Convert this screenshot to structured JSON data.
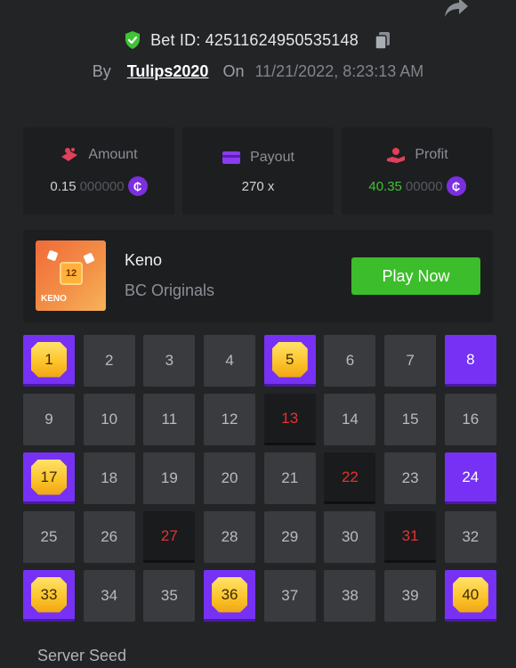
{
  "header": {
    "bet_id_label": "Bet ID: 42511624950535148",
    "by": "By",
    "user": "Tulips2020",
    "on": "On",
    "datetime": "11/21/2022, 8:23:13 AM"
  },
  "stats": {
    "amount": {
      "label": "Amount",
      "value_main": "0.15",
      "value_dim": "000000"
    },
    "payout": {
      "label": "Payout",
      "value": "270 x"
    },
    "profit": {
      "label": "Profit",
      "value_main": "40.35",
      "value_dim": "00000"
    }
  },
  "coin_symbol": "₵",
  "game": {
    "thumb_number": "12",
    "thumb_label": "KENO",
    "title": "Keno",
    "subtitle": "BC Originals",
    "play_label": "Play Now"
  },
  "grid": [
    {
      "n": "1",
      "s": "gem"
    },
    {
      "n": "2",
      "s": "none"
    },
    {
      "n": "3",
      "s": "none"
    },
    {
      "n": "4",
      "s": "none"
    },
    {
      "n": "5",
      "s": "gem"
    },
    {
      "n": "6",
      "s": "none"
    },
    {
      "n": "7",
      "s": "none"
    },
    {
      "n": "8",
      "s": "sel"
    },
    {
      "n": "9",
      "s": "none"
    },
    {
      "n": "10",
      "s": "none"
    },
    {
      "n": "11",
      "s": "none"
    },
    {
      "n": "12",
      "s": "none"
    },
    {
      "n": "13",
      "s": "miss"
    },
    {
      "n": "14",
      "s": "none"
    },
    {
      "n": "15",
      "s": "none"
    },
    {
      "n": "16",
      "s": "none"
    },
    {
      "n": "17",
      "s": "gem"
    },
    {
      "n": "18",
      "s": "none"
    },
    {
      "n": "19",
      "s": "none"
    },
    {
      "n": "20",
      "s": "none"
    },
    {
      "n": "21",
      "s": "none"
    },
    {
      "n": "22",
      "s": "miss"
    },
    {
      "n": "23",
      "s": "none"
    },
    {
      "n": "24",
      "s": "sel"
    },
    {
      "n": "25",
      "s": "none"
    },
    {
      "n": "26",
      "s": "none"
    },
    {
      "n": "27",
      "s": "miss"
    },
    {
      "n": "28",
      "s": "none"
    },
    {
      "n": "29",
      "s": "none"
    },
    {
      "n": "30",
      "s": "none"
    },
    {
      "n": "31",
      "s": "miss"
    },
    {
      "n": "32",
      "s": "none"
    },
    {
      "n": "33",
      "s": "gem"
    },
    {
      "n": "34",
      "s": "none"
    },
    {
      "n": "35",
      "s": "none"
    },
    {
      "n": "36",
      "s": "gem"
    },
    {
      "n": "37",
      "s": "none"
    },
    {
      "n": "38",
      "s": "none"
    },
    {
      "n": "39",
      "s": "none"
    },
    {
      "n": "40",
      "s": "gem"
    }
  ],
  "colors": {
    "accent_purple": "#7631f4",
    "play_green": "#3cbd2b",
    "profit_green": "#3fc335",
    "miss_red": "#e4322f",
    "gem_gold": "#fcc52c"
  },
  "footer": {
    "server_seed_label": "Server Seed"
  }
}
